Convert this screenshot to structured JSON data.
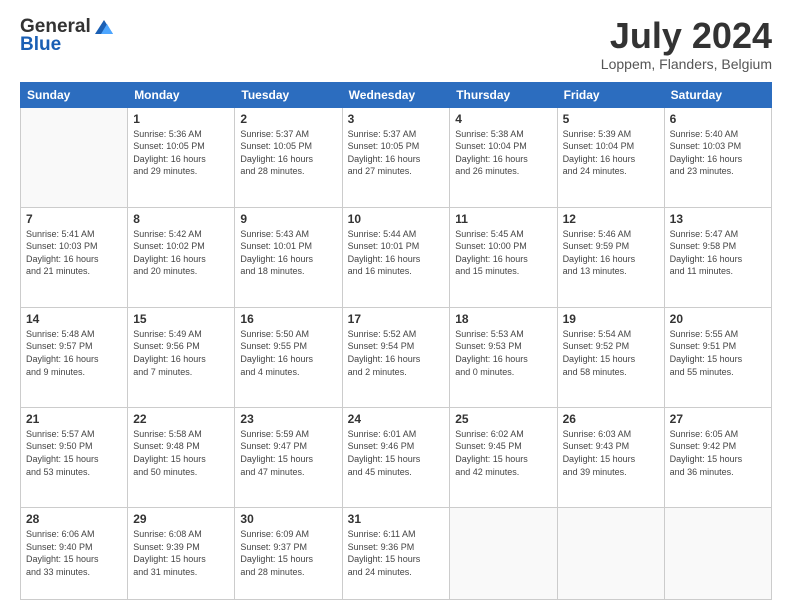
{
  "logo": {
    "general": "General",
    "blue": "Blue"
  },
  "header": {
    "month": "July 2024",
    "location": "Loppem, Flanders, Belgium"
  },
  "days_of_week": [
    "Sunday",
    "Monday",
    "Tuesday",
    "Wednesday",
    "Thursday",
    "Friday",
    "Saturday"
  ],
  "weeks": [
    [
      {
        "day": "",
        "sunrise": "",
        "sunset": "",
        "daylight": ""
      },
      {
        "day": "1",
        "sunrise": "Sunrise: 5:36 AM",
        "sunset": "Sunset: 10:05 PM",
        "daylight": "Daylight: 16 hours and 29 minutes."
      },
      {
        "day": "2",
        "sunrise": "Sunrise: 5:37 AM",
        "sunset": "Sunset: 10:05 PM",
        "daylight": "Daylight: 16 hours and 28 minutes."
      },
      {
        "day": "3",
        "sunrise": "Sunrise: 5:37 AM",
        "sunset": "Sunset: 10:05 PM",
        "daylight": "Daylight: 16 hours and 27 minutes."
      },
      {
        "day": "4",
        "sunrise": "Sunrise: 5:38 AM",
        "sunset": "Sunset: 10:04 PM",
        "daylight": "Daylight: 16 hours and 26 minutes."
      },
      {
        "day": "5",
        "sunrise": "Sunrise: 5:39 AM",
        "sunset": "Sunset: 10:04 PM",
        "daylight": "Daylight: 16 hours and 24 minutes."
      },
      {
        "day": "6",
        "sunrise": "Sunrise: 5:40 AM",
        "sunset": "Sunset: 10:03 PM",
        "daylight": "Daylight: 16 hours and 23 minutes."
      }
    ],
    [
      {
        "day": "7",
        "sunrise": "Sunrise: 5:41 AM",
        "sunset": "Sunset: 10:03 PM",
        "daylight": "Daylight: 16 hours and 21 minutes."
      },
      {
        "day": "8",
        "sunrise": "Sunrise: 5:42 AM",
        "sunset": "Sunset: 10:02 PM",
        "daylight": "Daylight: 16 hours and 20 minutes."
      },
      {
        "day": "9",
        "sunrise": "Sunrise: 5:43 AM",
        "sunset": "Sunset: 10:01 PM",
        "daylight": "Daylight: 16 hours and 18 minutes."
      },
      {
        "day": "10",
        "sunrise": "Sunrise: 5:44 AM",
        "sunset": "Sunset: 10:01 PM",
        "daylight": "Daylight: 16 hours and 16 minutes."
      },
      {
        "day": "11",
        "sunrise": "Sunrise: 5:45 AM",
        "sunset": "Sunset: 10:00 PM",
        "daylight": "Daylight: 16 hours and 15 minutes."
      },
      {
        "day": "12",
        "sunrise": "Sunrise: 5:46 AM",
        "sunset": "Sunset: 9:59 PM",
        "daylight": "Daylight: 16 hours and 13 minutes."
      },
      {
        "day": "13",
        "sunrise": "Sunrise: 5:47 AM",
        "sunset": "Sunset: 9:58 PM",
        "daylight": "Daylight: 16 hours and 11 minutes."
      }
    ],
    [
      {
        "day": "14",
        "sunrise": "Sunrise: 5:48 AM",
        "sunset": "Sunset: 9:57 PM",
        "daylight": "Daylight: 16 hours and 9 minutes."
      },
      {
        "day": "15",
        "sunrise": "Sunrise: 5:49 AM",
        "sunset": "Sunset: 9:56 PM",
        "daylight": "Daylight: 16 hours and 7 minutes."
      },
      {
        "day": "16",
        "sunrise": "Sunrise: 5:50 AM",
        "sunset": "Sunset: 9:55 PM",
        "daylight": "Daylight: 16 hours and 4 minutes."
      },
      {
        "day": "17",
        "sunrise": "Sunrise: 5:52 AM",
        "sunset": "Sunset: 9:54 PM",
        "daylight": "Daylight: 16 hours and 2 minutes."
      },
      {
        "day": "18",
        "sunrise": "Sunrise: 5:53 AM",
        "sunset": "Sunset: 9:53 PM",
        "daylight": "Daylight: 16 hours and 0 minutes."
      },
      {
        "day": "19",
        "sunrise": "Sunrise: 5:54 AM",
        "sunset": "Sunset: 9:52 PM",
        "daylight": "Daylight: 15 hours and 58 minutes."
      },
      {
        "day": "20",
        "sunrise": "Sunrise: 5:55 AM",
        "sunset": "Sunset: 9:51 PM",
        "daylight": "Daylight: 15 hours and 55 minutes."
      }
    ],
    [
      {
        "day": "21",
        "sunrise": "Sunrise: 5:57 AM",
        "sunset": "Sunset: 9:50 PM",
        "daylight": "Daylight: 15 hours and 53 minutes."
      },
      {
        "day": "22",
        "sunrise": "Sunrise: 5:58 AM",
        "sunset": "Sunset: 9:48 PM",
        "daylight": "Daylight: 15 hours and 50 minutes."
      },
      {
        "day": "23",
        "sunrise": "Sunrise: 5:59 AM",
        "sunset": "Sunset: 9:47 PM",
        "daylight": "Daylight: 15 hours and 47 minutes."
      },
      {
        "day": "24",
        "sunrise": "Sunrise: 6:01 AM",
        "sunset": "Sunset: 9:46 PM",
        "daylight": "Daylight: 15 hours and 45 minutes."
      },
      {
        "day": "25",
        "sunrise": "Sunrise: 6:02 AM",
        "sunset": "Sunset: 9:45 PM",
        "daylight": "Daylight: 15 hours and 42 minutes."
      },
      {
        "day": "26",
        "sunrise": "Sunrise: 6:03 AM",
        "sunset": "Sunset: 9:43 PM",
        "daylight": "Daylight: 15 hours and 39 minutes."
      },
      {
        "day": "27",
        "sunrise": "Sunrise: 6:05 AM",
        "sunset": "Sunset: 9:42 PM",
        "daylight": "Daylight: 15 hours and 36 minutes."
      }
    ],
    [
      {
        "day": "28",
        "sunrise": "Sunrise: 6:06 AM",
        "sunset": "Sunset: 9:40 PM",
        "daylight": "Daylight: 15 hours and 33 minutes."
      },
      {
        "day": "29",
        "sunrise": "Sunrise: 6:08 AM",
        "sunset": "Sunset: 9:39 PM",
        "daylight": "Daylight: 15 hours and 31 minutes."
      },
      {
        "day": "30",
        "sunrise": "Sunrise: 6:09 AM",
        "sunset": "Sunset: 9:37 PM",
        "daylight": "Daylight: 15 hours and 28 minutes."
      },
      {
        "day": "31",
        "sunrise": "Sunrise: 6:11 AM",
        "sunset": "Sunset: 9:36 PM",
        "daylight": "Daylight: 15 hours and 24 minutes."
      },
      {
        "day": "",
        "sunrise": "",
        "sunset": "",
        "daylight": ""
      },
      {
        "day": "",
        "sunrise": "",
        "sunset": "",
        "daylight": ""
      },
      {
        "day": "",
        "sunrise": "",
        "sunset": "",
        "daylight": ""
      }
    ]
  ]
}
